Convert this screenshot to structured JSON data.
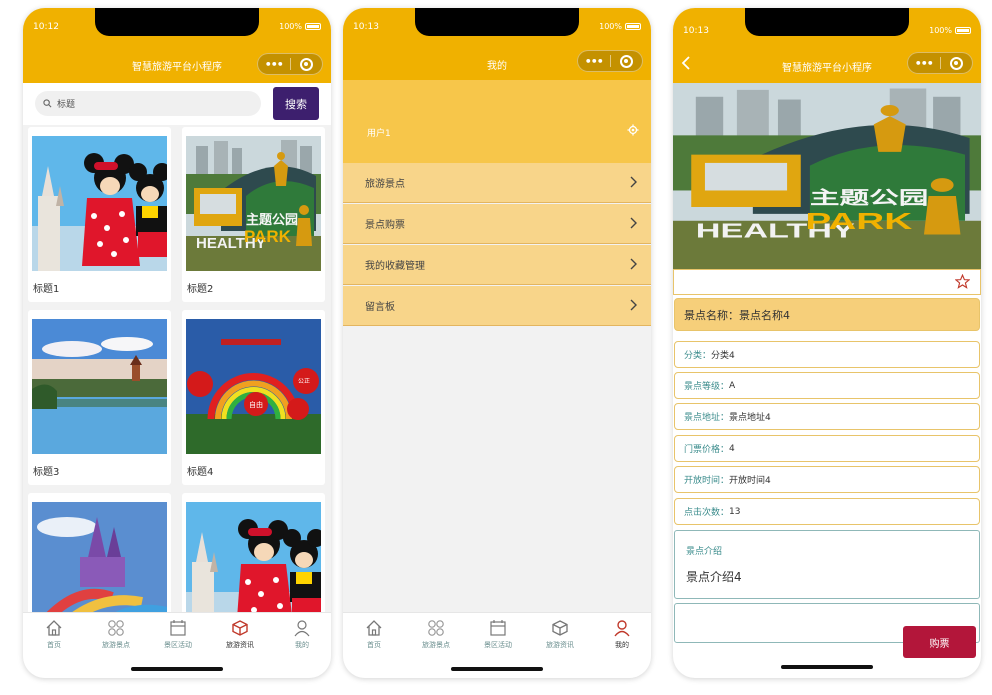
{
  "screens": {
    "home": {
      "status": {
        "time": "10:12",
        "battery": "100%"
      },
      "title": "智慧旅游平台小程序",
      "search": {
        "placeholder": "标题",
        "button": "搜索"
      },
      "cards": [
        {
          "title": "标题1",
          "image": "mickey-minnie-castle"
        },
        {
          "title": "标题2",
          "image": "healthy-park-sign"
        },
        {
          "title": "标题3",
          "image": "west-lake-pagoda"
        },
        {
          "title": "标题4",
          "image": "rainbow-flower-arch"
        },
        {
          "title": "",
          "image": "amusement-park-slides"
        },
        {
          "title": "",
          "image": "mickey-minnie-castle"
        }
      ],
      "active_tab": "旅游资讯"
    },
    "mine": {
      "status": {
        "time": "10:13",
        "battery": "100%"
      },
      "title": "我的",
      "user": "用户1",
      "menu": [
        "旅游景点",
        "景点购票",
        "我的收藏管理",
        "留言板"
      ],
      "active_tab": "我的"
    },
    "detail": {
      "status": {
        "time": "10:13",
        "battery": "100%"
      },
      "title": "智慧旅游平台小程序",
      "name_label": "景点名称：",
      "name_value": "景点名称4",
      "fields": [
        {
          "key": "分类：",
          "value": "分类4"
        },
        {
          "key": "景点等级：",
          "value": "A"
        },
        {
          "key": "景点地址：",
          "value": "景点地址4"
        },
        {
          "key": "门票价格：",
          "value": "4"
        },
        {
          "key": "开放时间：",
          "value": "开放时间4"
        },
        {
          "key": "点击次数：",
          "value": "13"
        }
      ],
      "intro_label": "景点介绍",
      "intro_text": "景点介绍4",
      "buy_button": "购票",
      "hero_image": "healthy-park-sign"
    }
  },
  "tabs": [
    {
      "label": "首页",
      "icon": "home-icon"
    },
    {
      "label": "旅游景点",
      "icon": "grid-icon"
    },
    {
      "label": "景区活动",
      "icon": "calendar-icon"
    },
    {
      "label": "旅游资讯",
      "icon": "cube-icon"
    },
    {
      "label": "我的",
      "icon": "user-icon"
    }
  ],
  "colors": {
    "brand": "#f0b100",
    "search_button": "#3d1f6e",
    "buy_button": "#b3163a",
    "label_teal": "#3b8c8c",
    "active_red": "#c0392b"
  }
}
